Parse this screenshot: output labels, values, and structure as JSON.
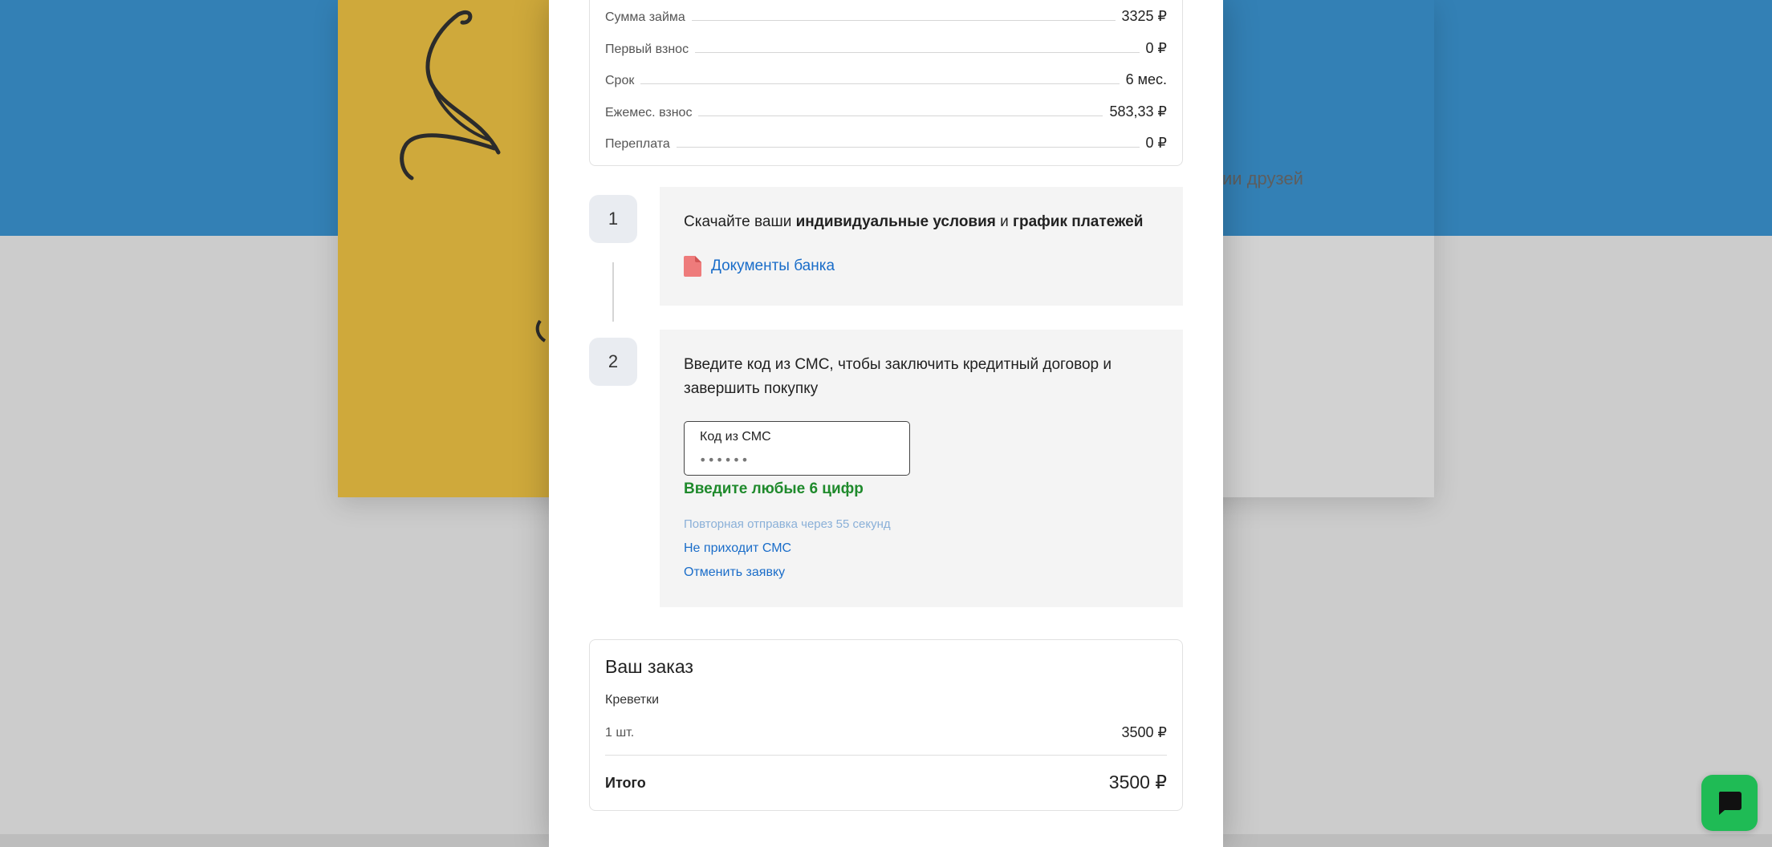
{
  "background": {
    "text_fragment": "ии друзей"
  },
  "loan_summary": {
    "rows": [
      {
        "label": "Сумма займа",
        "value": "3325 ₽"
      },
      {
        "label": "Первый взнос",
        "value": "0 ₽"
      },
      {
        "label": "Срок",
        "value": "6 мес."
      },
      {
        "label": "Ежемес. взнос",
        "value": "583,33 ₽"
      },
      {
        "label": "Переплата",
        "value": "0 ₽"
      }
    ]
  },
  "step1": {
    "number": "1",
    "text_before": "Скачайте ваши ",
    "text_bold_1": "индивидуальные условия",
    "text_mid": " и ",
    "text_bold_2": "график платежей",
    "doc_link": "Документы банка"
  },
  "step2": {
    "number": "2",
    "text": "Введите код из СМС, чтобы заключить кредитный договор и завершить покупку",
    "sms_label": "Код из СМС",
    "sms_placeholder": "••••••",
    "hint": "Введите любые 6 цифр",
    "resend": "Повторная отправка через 55 секунд",
    "no_sms_link": "Не приходит СМС",
    "cancel_link": "Отменить заявку"
  },
  "order": {
    "title": "Ваш заказ",
    "item_name": "Креветки",
    "quantity": "1 шт.",
    "price": "3500 ₽",
    "total_label": "Итого",
    "total_value": "3500 ₽"
  },
  "colors": {
    "link": "#1a6dc9",
    "hint_green": "#1f8a2c",
    "chat_button": "#1fbb55",
    "page_blue": "#3380b5",
    "image_yellow": "#cfa93b"
  },
  "icons": {
    "document": "document-icon",
    "chat": "chat-bubble-icon"
  }
}
